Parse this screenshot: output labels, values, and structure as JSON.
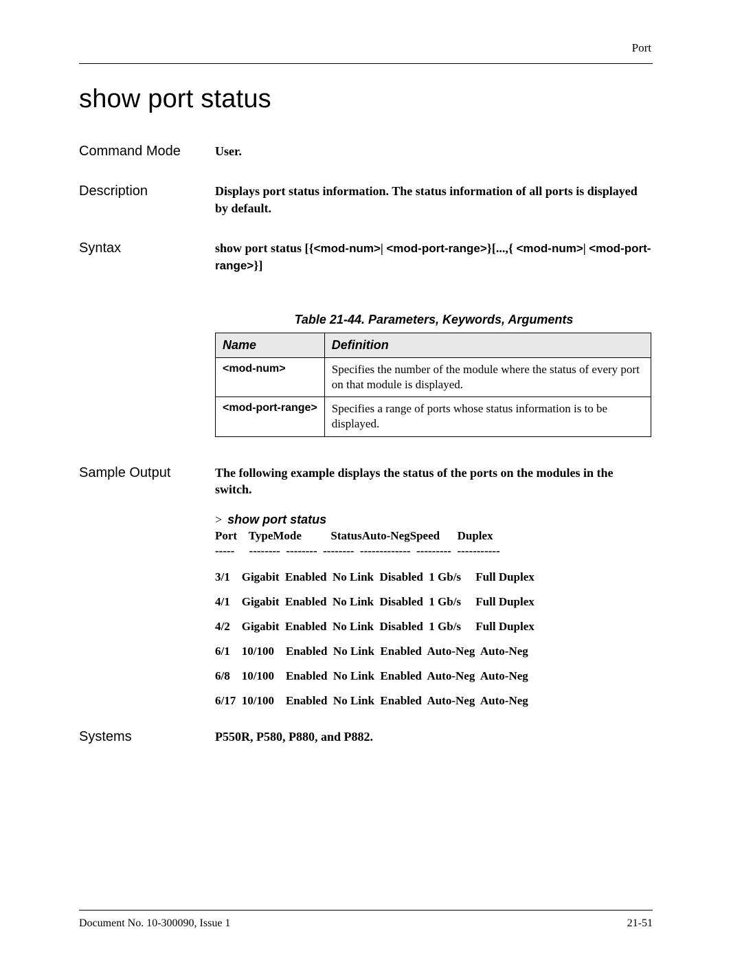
{
  "header": {
    "section": "Port"
  },
  "title": "show port status",
  "fields": {
    "commandMode": {
      "label": "Command Mode",
      "value": "User."
    },
    "description": {
      "label": "Description",
      "value": "Displays port status information. The status information of all ports is displayed by default."
    },
    "syntax": {
      "label": "Syntax",
      "prefix": "show port status [{",
      "p1": "<mod-num>",
      "sep1": "| ",
      "p2": "<mod-port-range>",
      "mid": "}[...,{ ",
      "p3": "<mod-num>",
      "sep2": "| ",
      "p4": "<mod-port-range>",
      "suffix": "}]"
    },
    "sampleOutputLabel": "Sample Output",
    "sampleOutputText": "The following example displays the status of the ports on the modules in the switch.",
    "systems": {
      "label": "Systems",
      "value": "P550R, P580, P880, and P882."
    }
  },
  "table": {
    "caption": "Table 21-44.  Parameters, Keywords, Arguments",
    "headers": [
      "Name",
      "Definition"
    ],
    "rows": [
      {
        "name": "<mod-num>",
        "definition": "Specifies the number of the module where the status of every port on that module is displayed."
      },
      {
        "name": "<mod-port-range>",
        "definition": "Specifies a range of ports whose status information is to be displayed."
      }
    ]
  },
  "sample": {
    "promptChar": ">",
    "promptCmd": "show port status",
    "columnsHeader": "Port    TypeMode          StatusAuto-NegSpeed      Duplex",
    "columnsDashes": "-----     --------  --------  --------  -------------  ---------  -----------",
    "rows": [
      "3/1    Gigabit  Enabled  No Link  Disabled  1 Gb/s     Full Duplex",
      "4/1    Gigabit  Enabled  No Link  Disabled  1 Gb/s     Full Duplex",
      "4/2    Gigabit  Enabled  No Link  Disabled  1 Gb/s     Full Duplex",
      "6/1    10/100    Enabled  No Link  Enabled  Auto-Neg  Auto-Neg",
      "6/8    10/100    Enabled  No Link  Enabled  Auto-Neg  Auto-Neg",
      "6/17  10/100    Enabled  No Link  Enabled  Auto-Neg  Auto-Neg"
    ]
  },
  "footer": {
    "left": "Document No. 10-300090, Issue 1",
    "right": "21-51"
  }
}
